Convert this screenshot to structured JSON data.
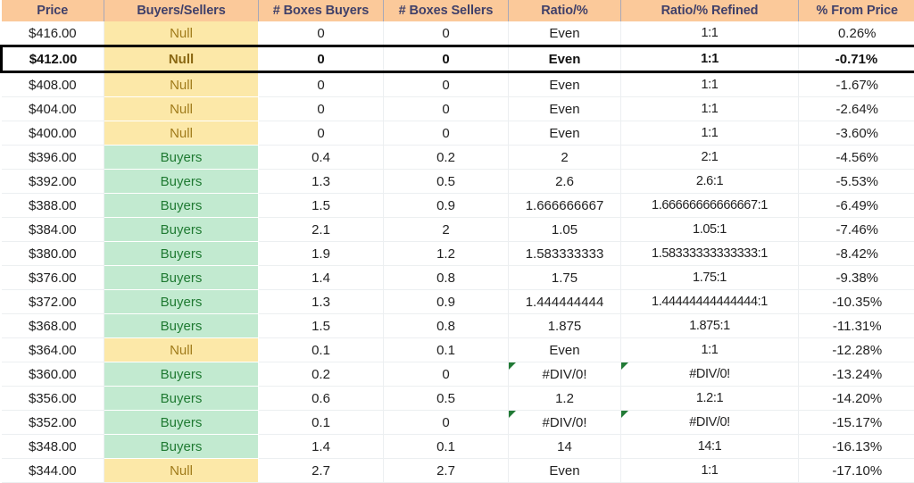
{
  "sheet": {
    "name": "price-ladder-buyers-sellers-table",
    "columns": [
      {
        "key": "price",
        "label": "Price"
      },
      {
        "key": "status",
        "label": "Buyers/Sellers"
      },
      {
        "key": "boxes_buyers",
        "label": "# Boxes Buyers"
      },
      {
        "key": "boxes_sellers",
        "label": "# Boxes Sellers"
      },
      {
        "key": "ratio",
        "label": "Ratio/%"
      },
      {
        "key": "refined",
        "label": "Ratio/% Refined"
      },
      {
        "key": "from_price",
        "label": "% From Price"
      }
    ],
    "colors": {
      "header_bg": "#fbc99a",
      "header_text": "#404069",
      "null_bg": "#fce8a8",
      "null_text": "#a07b1a",
      "buyers_bg": "#c2ead0",
      "buyers_text": "#1f7a32",
      "highlight_border": "#000000",
      "error_flag": "#217a35",
      "gridline": "#eceff1"
    },
    "highlighted_row_index": 1,
    "rows": [
      {
        "price": "$416.00",
        "status": "Null",
        "boxes_buyers": "0",
        "boxes_sellers": "0",
        "ratio": "Even",
        "refined": "1:1",
        "from_price": "0.26%",
        "ratio_error": false,
        "refined_error": false
      },
      {
        "price": "$412.00",
        "status": "Null",
        "boxes_buyers": "0",
        "boxes_sellers": "0",
        "ratio": "Even",
        "refined": "1:1",
        "from_price": "-0.71%",
        "ratio_error": false,
        "refined_error": false
      },
      {
        "price": "$408.00",
        "status": "Null",
        "boxes_buyers": "0",
        "boxes_sellers": "0",
        "ratio": "Even",
        "refined": "1:1",
        "from_price": "-1.67%",
        "ratio_error": false,
        "refined_error": false
      },
      {
        "price": "$404.00",
        "status": "Null",
        "boxes_buyers": "0",
        "boxes_sellers": "0",
        "ratio": "Even",
        "refined": "1:1",
        "from_price": "-2.64%",
        "ratio_error": false,
        "refined_error": false
      },
      {
        "price": "$400.00",
        "status": "Null",
        "boxes_buyers": "0",
        "boxes_sellers": "0",
        "ratio": "Even",
        "refined": "1:1",
        "from_price": "-3.60%",
        "ratio_error": false,
        "refined_error": false
      },
      {
        "price": "$396.00",
        "status": "Buyers",
        "boxes_buyers": "0.4",
        "boxes_sellers": "0.2",
        "ratio": "2",
        "refined": "2:1",
        "from_price": "-4.56%",
        "ratio_error": false,
        "refined_error": false
      },
      {
        "price": "$392.00",
        "status": "Buyers",
        "boxes_buyers": "1.3",
        "boxes_sellers": "0.5",
        "ratio": "2.6",
        "refined": "2.6:1",
        "from_price": "-5.53%",
        "ratio_error": false,
        "refined_error": false
      },
      {
        "price": "$388.00",
        "status": "Buyers",
        "boxes_buyers": "1.5",
        "boxes_sellers": "0.9",
        "ratio": "1.666666667",
        "refined": "1.66666666666667:1",
        "from_price": "-6.49%",
        "ratio_error": false,
        "refined_error": false
      },
      {
        "price": "$384.00",
        "status": "Buyers",
        "boxes_buyers": "2.1",
        "boxes_sellers": "2",
        "ratio": "1.05",
        "refined": "1.05:1",
        "from_price": "-7.46%",
        "ratio_error": false,
        "refined_error": false
      },
      {
        "price": "$380.00",
        "status": "Buyers",
        "boxes_buyers": "1.9",
        "boxes_sellers": "1.2",
        "ratio": "1.583333333",
        "refined": "1.58333333333333:1",
        "from_price": "-8.42%",
        "ratio_error": false,
        "refined_error": false
      },
      {
        "price": "$376.00",
        "status": "Buyers",
        "boxes_buyers": "1.4",
        "boxes_sellers": "0.8",
        "ratio": "1.75",
        "refined": "1.75:1",
        "from_price": "-9.38%",
        "ratio_error": false,
        "refined_error": false
      },
      {
        "price": "$372.00",
        "status": "Buyers",
        "boxes_buyers": "1.3",
        "boxes_sellers": "0.9",
        "ratio": "1.444444444",
        "refined": "1.44444444444444:1",
        "from_price": "-10.35%",
        "ratio_error": false,
        "refined_error": false
      },
      {
        "price": "$368.00",
        "status": "Buyers",
        "boxes_buyers": "1.5",
        "boxes_sellers": "0.8",
        "ratio": "1.875",
        "refined": "1.875:1",
        "from_price": "-11.31%",
        "ratio_error": false,
        "refined_error": false
      },
      {
        "price": "$364.00",
        "status": "Null",
        "boxes_buyers": "0.1",
        "boxes_sellers": "0.1",
        "ratio": "Even",
        "refined": "1:1",
        "from_price": "-12.28%",
        "ratio_error": false,
        "refined_error": false
      },
      {
        "price": "$360.00",
        "status": "Buyers",
        "boxes_buyers": "0.2",
        "boxes_sellers": "0",
        "ratio": "#DIV/0!",
        "refined": "#DIV/0!",
        "from_price": "-13.24%",
        "ratio_error": true,
        "refined_error": true
      },
      {
        "price": "$356.00",
        "status": "Buyers",
        "boxes_buyers": "0.6",
        "boxes_sellers": "0.5",
        "ratio": "1.2",
        "refined": "1.2:1",
        "from_price": "-14.20%",
        "ratio_error": false,
        "refined_error": false
      },
      {
        "price": "$352.00",
        "status": "Buyers",
        "boxes_buyers": "0.1",
        "boxes_sellers": "0",
        "ratio": "#DIV/0!",
        "refined": "#DIV/0!",
        "from_price": "-15.17%",
        "ratio_error": true,
        "refined_error": true
      },
      {
        "price": "$348.00",
        "status": "Buyers",
        "boxes_buyers": "1.4",
        "boxes_sellers": "0.1",
        "ratio": "14",
        "refined": "14:1",
        "from_price": "-16.13%",
        "ratio_error": false,
        "refined_error": false
      },
      {
        "price": "$344.00",
        "status": "Null",
        "boxes_buyers": "2.7",
        "boxes_sellers": "2.7",
        "ratio": "Even",
        "refined": "1:1",
        "from_price": "-17.10%",
        "ratio_error": false,
        "refined_error": false
      }
    ]
  }
}
